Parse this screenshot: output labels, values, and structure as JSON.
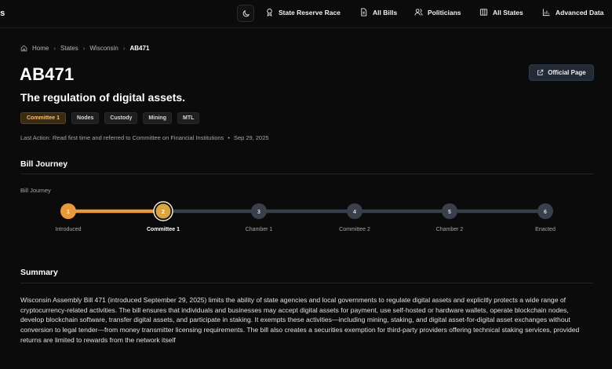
{
  "brand": "vs",
  "nav": [
    {
      "label": "State Reserve Race",
      "icon": "seal-icon"
    },
    {
      "label": "All Bills",
      "icon": "document-icon"
    },
    {
      "label": "Politicians",
      "icon": "people-icon"
    },
    {
      "label": "All States",
      "icon": "map-icon"
    },
    {
      "label": "Advanced Data",
      "icon": "bar-chart-icon"
    }
  ],
  "theme_toggle_icon": "moon-icon",
  "breadcrumb": {
    "home": "Home",
    "states": "States",
    "state": "Wisconsin",
    "current": "AB471"
  },
  "bill": {
    "id": "AB471",
    "title": "The regulation of digital assets.",
    "official_button": "Official Page",
    "status_tag": "Committee 1",
    "tags": [
      "Nodes",
      "Custody",
      "Mining",
      "MTL"
    ],
    "last_action_label": "Last Action: Read first time and referred to Committee on Financial Institutions",
    "last_action_date": "Sep 29, 2025"
  },
  "journey": {
    "section_title": "Bill Journey",
    "label": "Bill Journey",
    "current_step": 2,
    "steps": [
      {
        "number": "1",
        "label": "Introduced"
      },
      {
        "number": "2",
        "label": "Committee 1"
      },
      {
        "number": "3",
        "label": "Chamber 1"
      },
      {
        "number": "4",
        "label": "Committee 2"
      },
      {
        "number": "5",
        "label": "Chamber 2"
      },
      {
        "number": "6",
        "label": "Enacted"
      }
    ],
    "colors": {
      "done": "#e89a3c",
      "current": "#d9a441",
      "pending": "#3a3f4c"
    }
  },
  "summary": {
    "title": "Summary",
    "text": "Wisconsin Assembly Bill 471 (introduced September 29, 2025) limits the ability of state agencies and local governments to regulate digital assets and explicitly protects a wide range of cryptocurrency-related activities. The bill ensures that individuals and businesses may accept digital assets for payment, use self-hosted or hardware wallets, operate blockchain nodes, develop blockchain software, transfer digital assets, and participate in staking. It exempts these activities—including mining, staking, and digital asset-for-digital asset exchanges without conversion to legal tender—from money transmitter licensing requirements. The bill also creates a securities exemption for third-party providers offering technical staking services, provided returns are limited to rewards from the network itself"
  }
}
